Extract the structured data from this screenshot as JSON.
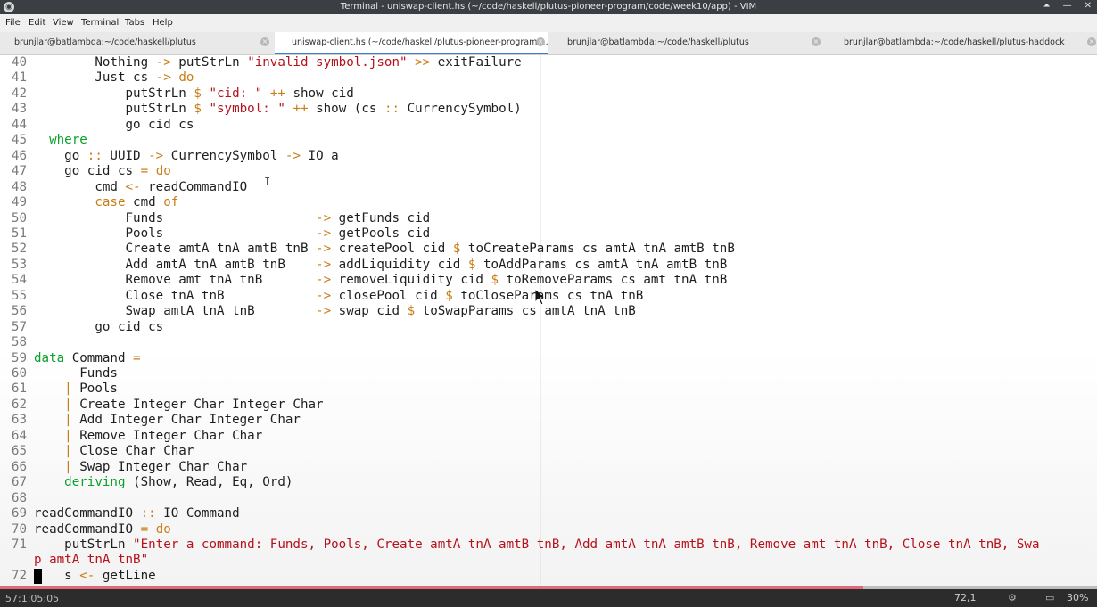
{
  "window": {
    "title": "Terminal - uniswap-client.hs (~/code/haskell/plutus-pioneer-program/code/week10/app) - VIM"
  },
  "menu": [
    "File",
    "Edit",
    "View",
    "Terminal",
    "Tabs",
    "Help"
  ],
  "tabs": [
    {
      "label": "brunjlar@batlambda:~/code/haskell/plutus",
      "active": false
    },
    {
      "label": "uniswap-client.hs (~/code/haskell/plutus-pioneer-program/...",
      "active": true
    },
    {
      "label": "brunjlar@batlambda:~/code/haskell/plutus",
      "active": false
    },
    {
      "label": "brunjlar@batlambda:~/code/haskell/plutus-haddock",
      "active": false
    }
  ],
  "editor": {
    "lines": [
      {
        "n": "40",
        "t": [
          [
            "",
            "        Nothing "
          ],
          [
            "o",
            "->"
          ],
          [
            "",
            " putStrLn "
          ],
          [
            "s",
            "\"invalid symbol.json\""
          ],
          [
            "",
            " "
          ],
          [
            "o",
            ">>"
          ],
          [
            "",
            " exitFailure"
          ]
        ]
      },
      {
        "n": "41",
        "t": [
          [
            "",
            "        Just cs "
          ],
          [
            "o",
            "->"
          ],
          [
            "",
            " "
          ],
          [
            "o",
            "do"
          ]
        ]
      },
      {
        "n": "42",
        "t": [
          [
            "",
            "            putStrLn "
          ],
          [
            "o",
            "$"
          ],
          [
            "",
            " "
          ],
          [
            "s",
            "\"cid: \""
          ],
          [
            "",
            " "
          ],
          [
            "o",
            "++"
          ],
          [
            "",
            " show cid"
          ]
        ]
      },
      {
        "n": "43",
        "t": [
          [
            "",
            "            putStrLn "
          ],
          [
            "o",
            "$"
          ],
          [
            "",
            " "
          ],
          [
            "s",
            "\"symbol: \""
          ],
          [
            "",
            " "
          ],
          [
            "o",
            "++"
          ],
          [
            "",
            " show (cs "
          ],
          [
            "o",
            "::"
          ],
          [
            "",
            " CurrencySymbol)"
          ]
        ]
      },
      {
        "n": "44",
        "t": [
          [
            "",
            "            go cid cs"
          ]
        ]
      },
      {
        "n": "45",
        "t": [
          [
            "",
            "  "
          ],
          [
            "k",
            "where"
          ]
        ]
      },
      {
        "n": "46",
        "t": [
          [
            "",
            "    go "
          ],
          [
            "o",
            "::"
          ],
          [
            "",
            " UUID "
          ],
          [
            "o",
            "->"
          ],
          [
            "",
            " CurrencySymbol "
          ],
          [
            "o",
            "->"
          ],
          [
            "",
            " IO a"
          ]
        ]
      },
      {
        "n": "47",
        "t": [
          [
            "",
            "    go cid cs "
          ],
          [
            "o",
            "="
          ],
          [
            "",
            " "
          ],
          [
            "o",
            "do"
          ]
        ]
      },
      {
        "n": "48",
        "t": [
          [
            "",
            "        cmd "
          ],
          [
            "o",
            "<-"
          ],
          [
            "",
            " readCommandIO"
          ]
        ]
      },
      {
        "n": "49",
        "t": [
          [
            "",
            "        "
          ],
          [
            "o",
            "case"
          ],
          [
            "",
            " cmd "
          ],
          [
            "o",
            "of"
          ]
        ]
      },
      {
        "n": "50",
        "t": [
          [
            "",
            "            Funds                    "
          ],
          [
            "o",
            "->"
          ],
          [
            "",
            " getFunds cid"
          ]
        ]
      },
      {
        "n": "51",
        "t": [
          [
            "",
            "            Pools                    "
          ],
          [
            "o",
            "->"
          ],
          [
            "",
            " getPools cid"
          ]
        ]
      },
      {
        "n": "52",
        "t": [
          [
            "",
            "            Create amtA tnA amtB tnB "
          ],
          [
            "o",
            "->"
          ],
          [
            "",
            " createPool cid "
          ],
          [
            "o",
            "$"
          ],
          [
            "",
            " toCreateParams cs amtA tnA amtB tnB"
          ]
        ]
      },
      {
        "n": "53",
        "t": [
          [
            "",
            "            Add amtA tnA amtB tnB    "
          ],
          [
            "o",
            "->"
          ],
          [
            "",
            " addLiquidity cid "
          ],
          [
            "o",
            "$"
          ],
          [
            "",
            " toAddParams cs amtA tnA amtB tnB"
          ]
        ]
      },
      {
        "n": "54",
        "t": [
          [
            "",
            "            Remove amt tnA tnB       "
          ],
          [
            "o",
            "->"
          ],
          [
            "",
            " removeLiquidity cid "
          ],
          [
            "o",
            "$"
          ],
          [
            "",
            " toRemoveParams cs amt tnA tnB"
          ]
        ]
      },
      {
        "n": "55",
        "t": [
          [
            "",
            "            Close tnA tnB            "
          ],
          [
            "o",
            "->"
          ],
          [
            "",
            " closePool cid "
          ],
          [
            "o",
            "$"
          ],
          [
            "",
            " toCloseParams cs tnA tnB"
          ]
        ]
      },
      {
        "n": "56",
        "t": [
          [
            "",
            "            Swap amtA tnA tnB        "
          ],
          [
            "o",
            "->"
          ],
          [
            "",
            " swap cid "
          ],
          [
            "o",
            "$"
          ],
          [
            "",
            " toSwapParams cs amtA tnA tnB"
          ]
        ]
      },
      {
        "n": "57",
        "t": [
          [
            "",
            "        go cid cs"
          ]
        ]
      },
      {
        "n": "58",
        "t": []
      },
      {
        "n": "59",
        "t": [
          [
            "k",
            "data"
          ],
          [
            "",
            " Command "
          ],
          [
            "o",
            "="
          ]
        ]
      },
      {
        "n": "60",
        "t": [
          [
            "",
            "      Funds"
          ]
        ]
      },
      {
        "n": "61",
        "t": [
          [
            "",
            "    "
          ],
          [
            "o",
            "|"
          ],
          [
            "",
            " Pools"
          ]
        ]
      },
      {
        "n": "62",
        "t": [
          [
            "",
            "    "
          ],
          [
            "o",
            "|"
          ],
          [
            "",
            " Create Integer Char Integer Char"
          ]
        ]
      },
      {
        "n": "63",
        "t": [
          [
            "",
            "    "
          ],
          [
            "o",
            "|"
          ],
          [
            "",
            " Add Integer Char Integer Char"
          ]
        ]
      },
      {
        "n": "64",
        "t": [
          [
            "",
            "    "
          ],
          [
            "o",
            "|"
          ],
          [
            "",
            " Remove Integer Char Char"
          ]
        ]
      },
      {
        "n": "65",
        "t": [
          [
            "",
            "    "
          ],
          [
            "o",
            "|"
          ],
          [
            "",
            " Close Char Char"
          ]
        ]
      },
      {
        "n": "66",
        "t": [
          [
            "",
            "    "
          ],
          [
            "o",
            "|"
          ],
          [
            "",
            " Swap Integer Char Char"
          ]
        ]
      },
      {
        "n": "67",
        "t": [
          [
            "",
            "    "
          ],
          [
            "k",
            "deriving"
          ],
          [
            "",
            " (Show, Read, Eq, Ord)"
          ]
        ]
      },
      {
        "n": "68",
        "t": []
      },
      {
        "n": "69",
        "t": [
          [
            "",
            "readCommandIO "
          ],
          [
            "o",
            "::"
          ],
          [
            "",
            " IO Command"
          ]
        ]
      },
      {
        "n": "70",
        "t": [
          [
            "",
            "readCommandIO "
          ],
          [
            "o",
            "="
          ],
          [
            "",
            " "
          ],
          [
            "o",
            "do"
          ]
        ]
      },
      {
        "n": "71",
        "t": [
          [
            "",
            "    putStrLn "
          ],
          [
            "s",
            "\"Enter a command: Funds, Pools, Create amtA tnA amtB tnB, Add amtA tnA amtB tnB, Remove amt tnA tnB, Close tnA tnB, Swa"
          ]
        ]
      },
      {
        "n": "",
        "t": [
          [
            "s",
            "p amtA tnA tnB\""
          ]
        ]
      },
      {
        "n": "72",
        "t": [
          [
            "",
            "    s "
          ],
          [
            "o",
            "<-"
          ],
          [
            "",
            " getLine"
          ]
        ]
      }
    ]
  },
  "status": {
    "position": "72,1",
    "percent": "30%",
    "time": "57:1:05:05"
  },
  "video_progress": 0.787,
  "colors": {
    "keyword": "#0aa02a",
    "string": "#b5121b",
    "operator": "#c87d16",
    "accent": "#3d7bd9"
  }
}
